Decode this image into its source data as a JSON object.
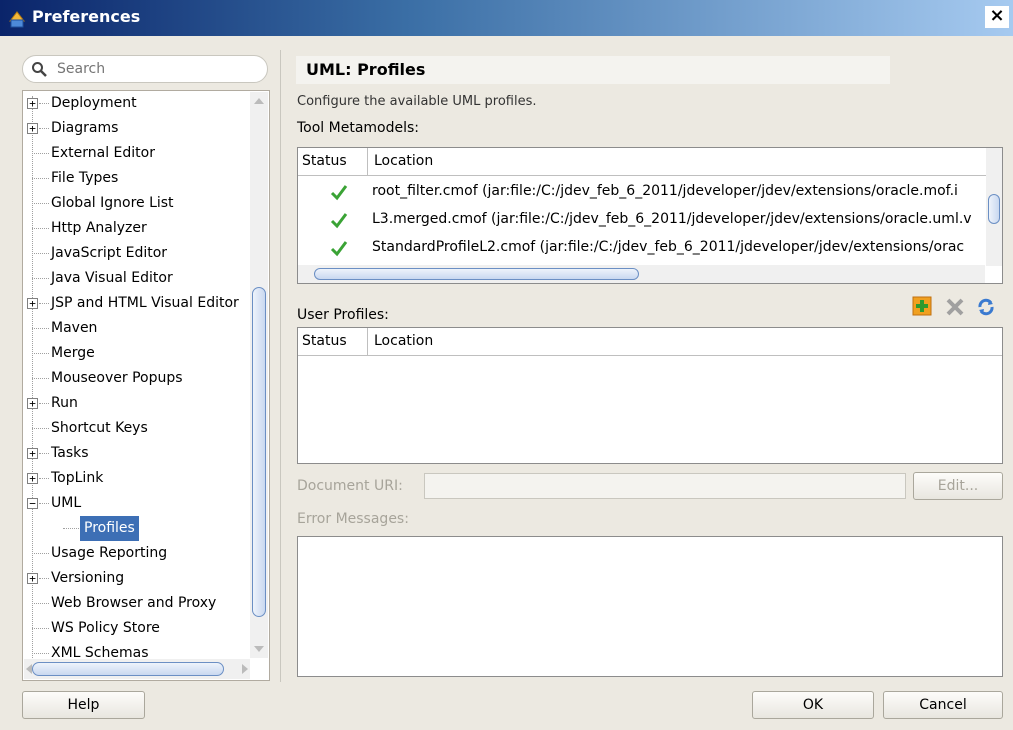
{
  "window": {
    "title": "Preferences",
    "close_label": "×"
  },
  "search": {
    "placeholder": "Search"
  },
  "tree": {
    "items": [
      {
        "label": "Deployment",
        "expandable": true
      },
      {
        "label": "Diagrams",
        "expandable": true
      },
      {
        "label": "External Editor",
        "expandable": false
      },
      {
        "label": "File Types",
        "expandable": false
      },
      {
        "label": "Global Ignore List",
        "expandable": false
      },
      {
        "label": "Http Analyzer",
        "expandable": false
      },
      {
        "label": "JavaScript Editor",
        "expandable": false
      },
      {
        "label": "Java Visual Editor",
        "expandable": false
      },
      {
        "label": "JSP and HTML Visual Editor",
        "expandable": true
      },
      {
        "label": "Maven",
        "expandable": false
      },
      {
        "label": "Merge",
        "expandable": false
      },
      {
        "label": "Mouseover Popups",
        "expandable": false
      },
      {
        "label": "Run",
        "expandable": true
      },
      {
        "label": "Shortcut Keys",
        "expandable": false
      },
      {
        "label": "Tasks",
        "expandable": true
      },
      {
        "label": "TopLink",
        "expandable": true
      },
      {
        "label": "UML",
        "expandable": true,
        "expanded": true
      },
      {
        "label": "Profiles",
        "child": true,
        "selected": true
      },
      {
        "label": "Usage Reporting",
        "expandable": false
      },
      {
        "label": "Versioning",
        "expandable": true
      },
      {
        "label": "Web Browser and Proxy",
        "expandable": false
      },
      {
        "label": "WS Policy Store",
        "expandable": false
      },
      {
        "label": "XML Schemas",
        "expandable": false
      }
    ]
  },
  "main": {
    "title": "UML: Profiles",
    "description": "Configure the available UML profiles.",
    "tool_metamodels_label": "Tool Metamodels:",
    "user_profiles_label": "User Profiles:",
    "status_col": "Status",
    "location_col": "Location",
    "metamodels": [
      {
        "status": "ok",
        "location": "root_filter.cmof (jar:file:/C:/jdev_feb_6_2011/jdeveloper/jdev/extensions/oracle.mof.i"
      },
      {
        "status": "ok",
        "location": "L3.merged.cmof (jar:file:/C:/jdev_feb_6_2011/jdeveloper/jdev/extensions/oracle.uml.v"
      },
      {
        "status": "ok",
        "location": "StandardProfileL2.cmof (jar:file:/C:/jdev_feb_6_2011/jdeveloper/jdev/extensions/orac"
      }
    ],
    "document_uri_label": "Document URI:",
    "document_uri_value": "",
    "edit_button": "Edit...",
    "error_messages_label": "Error Messages:"
  },
  "footer": {
    "help": "Help",
    "ok": "OK",
    "cancel": "Cancel"
  },
  "icons": {
    "add": "add-plus-icon",
    "remove": "remove-x-icon",
    "refresh": "refresh-icon",
    "check": "check-icon"
  },
  "colors": {
    "selection": "#3d6fb5",
    "check_green": "#3aa335",
    "add_orange": "#f0a020"
  }
}
